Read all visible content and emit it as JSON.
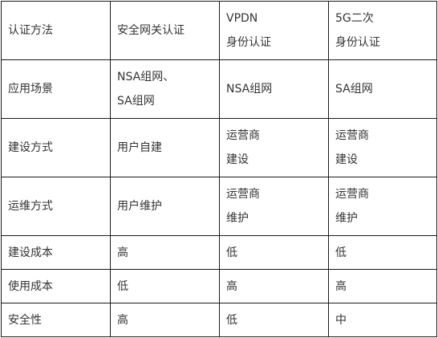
{
  "table": {
    "rows": [
      {
        "label": "认证方法",
        "cells": [
          [
            "安全网关认证"
          ],
          [
            "VPDN",
            "身份认证"
          ],
          [
            "5G二次",
            "身份认证"
          ]
        ]
      },
      {
        "label": "应用场景",
        "cells": [
          [
            "NSA组网、",
            "SA组网"
          ],
          [
            "NSA组网"
          ],
          [
            "SA组网"
          ]
        ]
      },
      {
        "label": "建设方式",
        "cells": [
          [
            "用户自建"
          ],
          [
            "运营商",
            "建设"
          ],
          [
            "运营商",
            "建设"
          ]
        ]
      },
      {
        "label": "运维方式",
        "cells": [
          [
            "用户维护"
          ],
          [
            "运营商",
            "维护"
          ],
          [
            "运营商",
            "维护"
          ]
        ]
      },
      {
        "label": "建设成本",
        "cells": [
          [
            "高"
          ],
          [
            "低"
          ],
          [
            "低"
          ]
        ]
      },
      {
        "label": "使用成本",
        "cells": [
          [
            "低"
          ],
          [
            "高"
          ],
          [
            "高"
          ]
        ]
      },
      {
        "label": "安全性",
        "cells": [
          [
            "高"
          ],
          [
            "低"
          ],
          [
            "中"
          ]
        ]
      }
    ]
  }
}
